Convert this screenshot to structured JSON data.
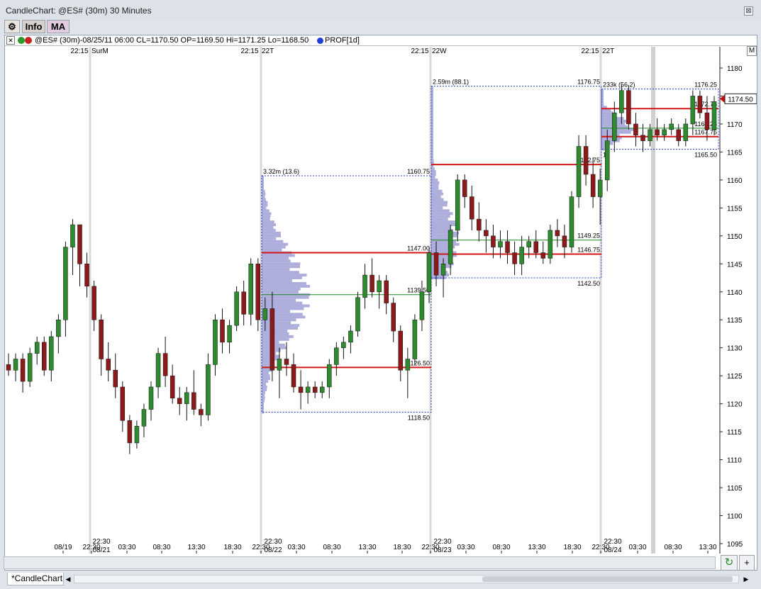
{
  "window": {
    "title": "CandleChart: @ES# (30m) 30 Minutes",
    "close_glyph": "⊠"
  },
  "toolbar": {
    "settings_glyph": "⚙",
    "info_label": "Info",
    "ma_label": "MA"
  },
  "infobar": {
    "close_glyph": "✕",
    "text": "@ES# (30m)-08/25/11 06:00 CL=1170.50 OP=1169.50 Hi=1171.25 Lo=1168.50",
    "prof_label": "PROF[1d]",
    "scale_button": "M"
  },
  "colors": {
    "up": "#2e8a2e",
    "down": "#8c1a1a",
    "profile": "#6c6cc0",
    "value_area_line": "#d01818",
    "poc_line": "#1c8a1c",
    "box": "#1c3fc2",
    "price_marker": "#c40c0c"
  },
  "chart_data": {
    "type": "candlestick",
    "symbol": "@ES#",
    "interval": "30m",
    "current_price": "1174.50",
    "y_axis": {
      "ticks": [
        "1180",
        "1175",
        "1170",
        "1165",
        "1160",
        "1155",
        "1150",
        "1145",
        "1140",
        "1135",
        "1130",
        "1125",
        "1120",
        "1115",
        "1110",
        "1105",
        "1100",
        "1095"
      ],
      "ylim": [
        1093,
        1183
      ]
    },
    "x_axis": {
      "ticks": [
        "08/19",
        "22:30",
        "03:30",
        "08:30",
        "13:30",
        "18:30",
        "22:30",
        "03:30",
        "08:30",
        "13:30",
        "18:30",
        "22:30",
        "03:30",
        "08:30",
        "13:30",
        "18:30",
        "22:30",
        "03:30",
        "08:30",
        "13:30"
      ]
    },
    "session_markers_top": [
      {
        "time": "22:15",
        "day": "SurM"
      },
      {
        "time": "22:15",
        "day": "22T"
      },
      {
        "time": "22:15",
        "day": "22W"
      },
      {
        "time": "22:15",
        "day": "22T"
      }
    ],
    "session_markers_bottom": [
      {
        "time": "22:30",
        "date": "08/21"
      },
      {
        "time": "22:30",
        "date": "08/22"
      },
      {
        "time": "22:30",
        "date": "08/23"
      },
      {
        "time": "22:30",
        "date": "08/24"
      }
    ],
    "profiles": [
      {
        "name": "08/22",
        "volume_label": "3.32m (13.6)",
        "high": 1160.75,
        "low": 1118.5,
        "vah": 1147.0,
        "poc": 1139.5,
        "val": 1126.5,
        "high_label": "1160.75",
        "low_label": "1118.50",
        "vah_label": "1147.00",
        "poc_label": "1139.50",
        "val_label": "1126.50"
      },
      {
        "name": "08/23",
        "volume_label": "2.59m (88.1)",
        "high": 1176.75,
        "low": 1142.5,
        "vah": 1162.75,
        "poc": 1149.25,
        "val": 1146.75,
        "high_label": "1176.75",
        "low_label": "1142.50",
        "vah_label": "1162.75",
        "poc_label": "1149.25",
        "val_label": "1146.75"
      },
      {
        "name": "08/24",
        "volume_label": "233k (56.2)",
        "period_label": "1d",
        "high": 1176.25,
        "low": 1165.5,
        "vah": 1172.75,
        "poc": 1169.25,
        "val": 1167.75,
        "high_label": "1176.25",
        "low_label": "1165.50",
        "vah_label": "1172.75",
        "poc_label": "1169.25",
        "val_label": "1167.75"
      }
    ],
    "candles": [
      [
        1127,
        1129,
        1125,
        1126
      ],
      [
        1126,
        1129,
        1124,
        1128
      ],
      [
        1128,
        1129,
        1122,
        1124
      ],
      [
        1124,
        1130,
        1123,
        1129
      ],
      [
        1129,
        1132,
        1127,
        1131
      ],
      [
        1131,
        1132,
        1125,
        1126
      ],
      [
        1126,
        1133,
        1124,
        1132
      ],
      [
        1132,
        1136,
        1129,
        1135
      ],
      [
        1135,
        1149,
        1132,
        1148
      ],
      [
        1148,
        1153,
        1143,
        1152
      ],
      [
        1152,
        1152,
        1141,
        1145
      ],
      [
        1145,
        1147,
        1139,
        1141
      ],
      [
        1141,
        1142,
        1133,
        1135
      ],
      [
        1135,
        1136,
        1125,
        1128
      ],
      [
        1128,
        1131,
        1124,
        1126
      ],
      [
        1126,
        1129,
        1121,
        1123
      ],
      [
        1123,
        1124,
        1115,
        1117
      ],
      [
        1117,
        1118,
        1111,
        1113
      ],
      [
        1113,
        1117,
        1112,
        1116
      ],
      [
        1116,
        1120,
        1114,
        1119
      ],
      [
        1119,
        1124,
        1117,
        1123
      ],
      [
        1123,
        1130,
        1121,
        1129
      ],
      [
        1129,
        1132,
        1123,
        1125
      ],
      [
        1125,
        1127,
        1120,
        1121
      ],
      [
        1121,
        1123,
        1118,
        1120
      ],
      [
        1120,
        1123,
        1117,
        1122
      ],
      [
        1122,
        1126,
        1118,
        1119
      ],
      [
        1119,
        1120,
        1116,
        1118
      ],
      [
        1118,
        1129,
        1117,
        1127
      ],
      [
        1127,
        1136,
        1125,
        1135
      ],
      [
        1135,
        1137,
        1129,
        1131
      ],
      [
        1131,
        1135,
        1129,
        1134
      ],
      [
        1134,
        1141,
        1133,
        1140
      ],
      [
        1140,
        1142,
        1134,
        1136
      ],
      [
        1136,
        1146,
        1134,
        1145
      ],
      [
        1145,
        1146,
        1133,
        1135
      ],
      [
        1135,
        1139,
        1133,
        1137
      ],
      [
        1137,
        1140,
        1124,
        1126
      ],
      [
        1126,
        1130,
        1121,
        1128
      ],
      [
        1128,
        1131,
        1125,
        1127
      ],
      [
        1127,
        1129,
        1122,
        1123
      ],
      [
        1123,
        1126,
        1119,
        1122
      ],
      [
        1122,
        1124,
        1120,
        1123
      ],
      [
        1123,
        1124,
        1121,
        1122
      ],
      [
        1122,
        1124,
        1121,
        1123
      ],
      [
        1123,
        1128,
        1121,
        1127
      ],
      [
        1127,
        1131,
        1125,
        1130
      ],
      [
        1130,
        1132,
        1128,
        1131
      ],
      [
        1131,
        1134,
        1129,
        1133
      ],
      [
        1133,
        1140,
        1132,
        1139
      ],
      [
        1139,
        1145,
        1137,
        1143
      ],
      [
        1143,
        1146,
        1139,
        1140
      ],
      [
        1140,
        1143,
        1137,
        1142
      ],
      [
        1142,
        1143,
        1136,
        1138
      ],
      [
        1138,
        1139,
        1131,
        1133
      ],
      [
        1133,
        1134,
        1124,
        1126
      ],
      [
        1126,
        1130,
        1121,
        1128
      ],
      [
        1128,
        1136,
        1127,
        1135
      ],
      [
        1135,
        1142,
        1133,
        1140
      ],
      [
        1140,
        1148,
        1138,
        1147
      ],
      [
        1147,
        1149,
        1141,
        1143
      ],
      [
        1143,
        1146,
        1139,
        1145
      ],
      [
        1145,
        1152,
        1143,
        1151
      ],
      [
        1151,
        1161,
        1149,
        1160
      ],
      [
        1160,
        1161,
        1155,
        1157
      ],
      [
        1157,
        1159,
        1151,
        1153
      ],
      [
        1153,
        1156,
        1149,
        1151
      ],
      [
        1151,
        1153,
        1147,
        1150
      ],
      [
        1150,
        1152,
        1146,
        1148
      ],
      [
        1148,
        1151,
        1146,
        1149
      ],
      [
        1149,
        1151,
        1145,
        1147
      ],
      [
        1147,
        1149,
        1143,
        1145
      ],
      [
        1145,
        1150,
        1143,
        1148
      ],
      [
        1148,
        1150,
        1146,
        1149
      ],
      [
        1149,
        1151,
        1146,
        1147
      ],
      [
        1147,
        1149,
        1145,
        1146
      ],
      [
        1146,
        1152,
        1145,
        1151
      ],
      [
        1151,
        1153,
        1148,
        1150
      ],
      [
        1150,
        1152,
        1146,
        1148
      ],
      [
        1148,
        1158,
        1147,
        1157
      ],
      [
        1157,
        1168,
        1155,
        1166
      ],
      [
        1166,
        1168,
        1159,
        1161
      ],
      [
        1161,
        1164,
        1155,
        1157
      ],
      [
        1157,
        1162,
        1152,
        1160
      ],
      [
        1160,
        1169,
        1158,
        1167
      ],
      [
        1167,
        1174,
        1165,
        1172
      ],
      [
        1172,
        1177,
        1170,
        1176
      ],
      [
        1176,
        1177,
        1169,
        1170
      ],
      [
        1170,
        1172,
        1166,
        1168
      ],
      [
        1168,
        1170,
        1165,
        1167
      ],
      [
        1167,
        1170,
        1166,
        1169
      ],
      [
        1169,
        1171,
        1167,
        1168
      ],
      [
        1168,
        1170,
        1167,
        1169
      ],
      [
        1169,
        1171,
        1168,
        1170
      ],
      [
        1169,
        1170,
        1166,
        1167
      ],
      [
        1167,
        1171,
        1166,
        1170
      ],
      [
        1170,
        1176,
        1168,
        1175
      ],
      [
        1175,
        1176,
        1171,
        1172
      ],
      [
        1172,
        1175,
        1167,
        1169
      ],
      [
        1169,
        1175,
        1168,
        1174
      ]
    ]
  },
  "nav": {
    "refresh_glyph": "↻",
    "add_glyph": "+"
  },
  "tabs": {
    "active_label": "*CandleChart",
    "left_glyph": "◀",
    "right_glyph": "▶"
  }
}
